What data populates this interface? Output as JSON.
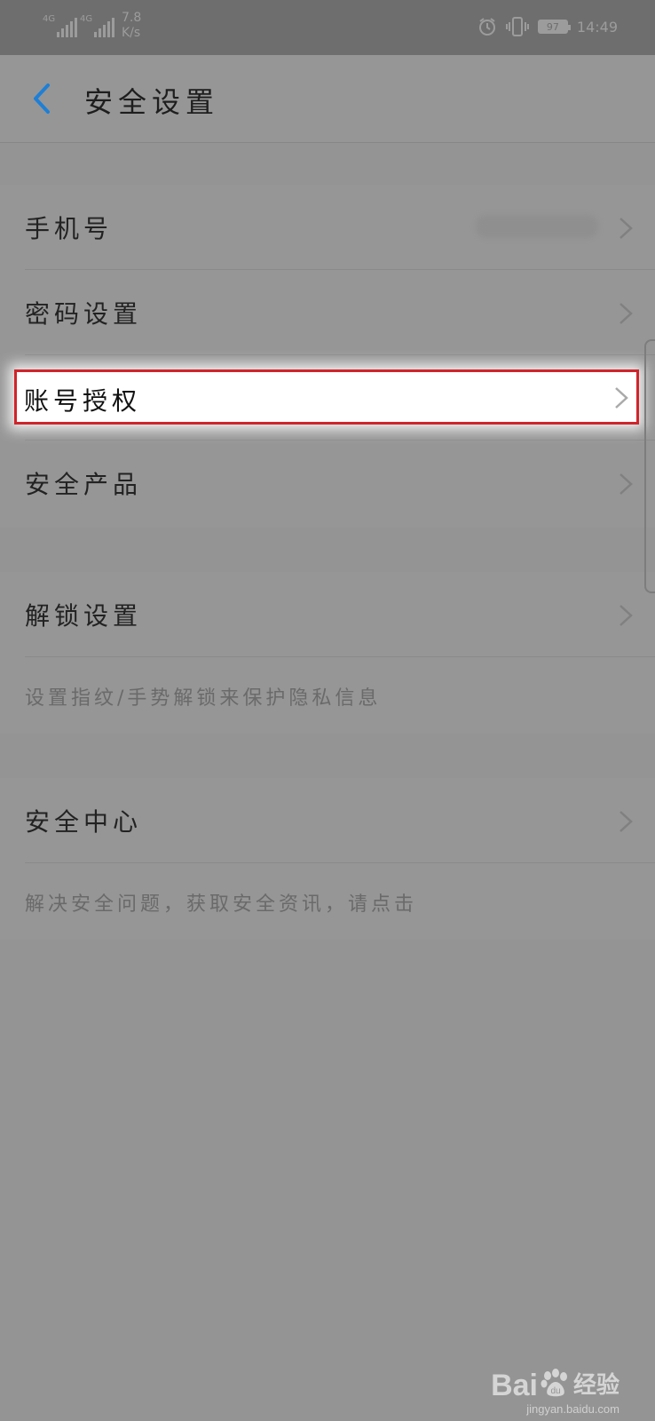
{
  "status_bar": {
    "signal1": "4G",
    "signal2": "4G",
    "speed_value": "7.8",
    "speed_unit": "K/s",
    "battery": "97",
    "time": "14:49",
    "icons": [
      "alarm-icon",
      "vibrate-icon",
      "battery-icon"
    ]
  },
  "header": {
    "title": "安全设置",
    "back_icon": "back-chevron-icon"
  },
  "group1": {
    "items": [
      {
        "label": "手机号"
      },
      {
        "label": "密码设置"
      },
      {
        "label": "账号授权"
      },
      {
        "label": "安全产品"
      }
    ]
  },
  "group2": {
    "label": "解锁设置",
    "description": "设置指纹/手势解锁来保护隐私信息"
  },
  "group3": {
    "label": "安全中心",
    "description": "解决安全问题，获取安全资讯，请点击"
  },
  "colors": {
    "highlight_border": "#d0242b",
    "accent": "#1e7fd6"
  },
  "watermark": {
    "brand_pre": "Bai",
    "brand_post": "经验",
    "url": "jingyan.baidu.com"
  }
}
